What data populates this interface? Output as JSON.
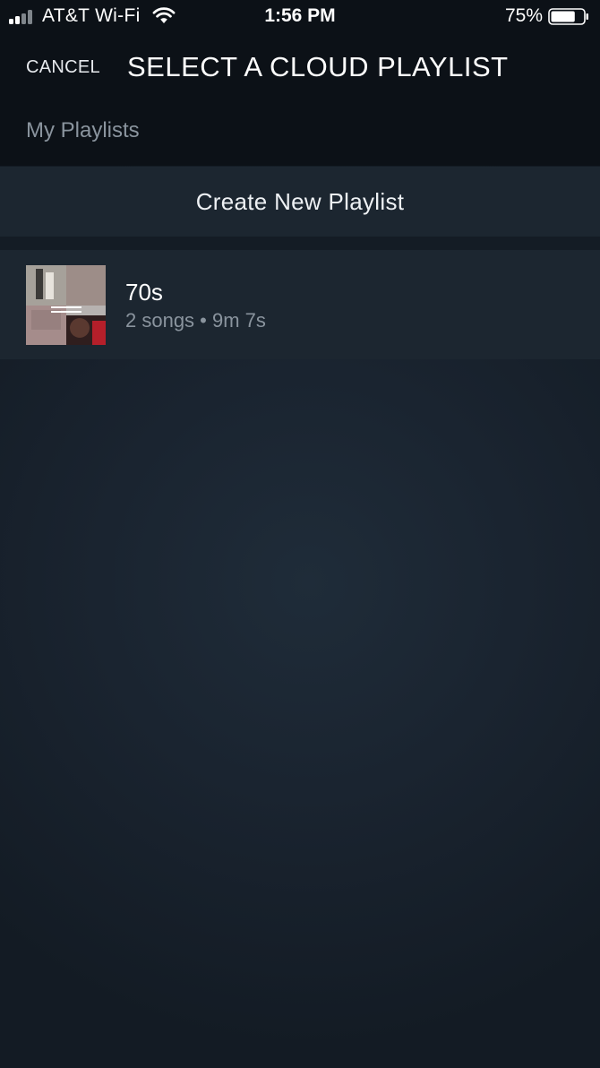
{
  "status_bar": {
    "carrier": "AT&T Wi-Fi",
    "time": "1:56 PM",
    "battery_percent": "75%",
    "battery_level": 0.75,
    "signal_bars": 2
  },
  "header": {
    "cancel_label": "CANCEL",
    "title": "SELECT A CLOUD PLAYLIST"
  },
  "section": {
    "label": "My Playlists"
  },
  "create_playlist": {
    "label": "Create New Playlist"
  },
  "playlists": [
    {
      "name": "70s",
      "meta": "2 songs • 9m 7s",
      "art_icon": "album-collage-icon"
    }
  ],
  "colors": {
    "header_bg": "#0c1117",
    "row_bg": "#1c2630",
    "secondary_text": "#8a949e"
  }
}
